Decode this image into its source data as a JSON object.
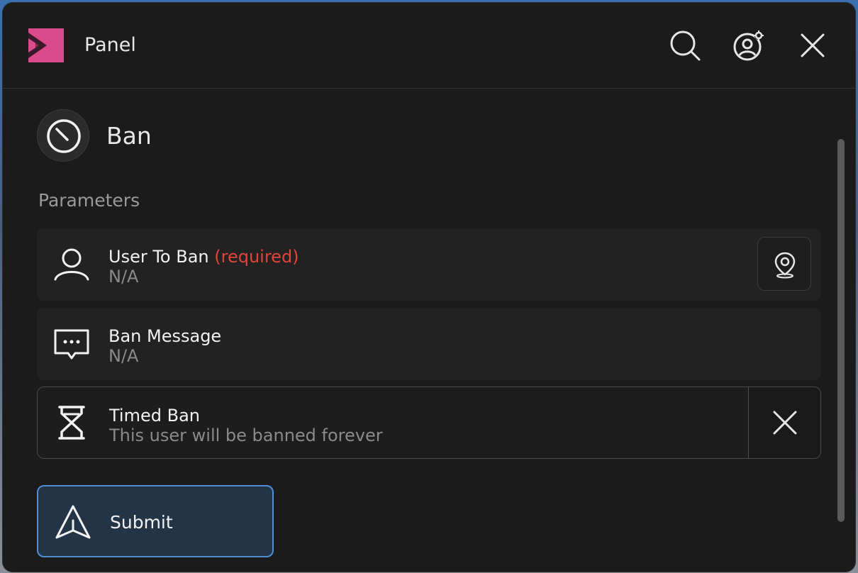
{
  "header": {
    "title": "Panel",
    "logo_icon": "brand-logo-icon",
    "logo_color": "#d94b8c"
  },
  "command": {
    "title": "Ban",
    "icon": "ban-icon"
  },
  "parameters": {
    "label": "Parameters",
    "items": [
      {
        "label": "User To Ban",
        "required_text": "(required)",
        "value": "N/A",
        "icon": "user-icon",
        "action_icon": "location-pin-icon"
      },
      {
        "label": "Ban Message",
        "value": "N/A",
        "icon": "message-icon"
      },
      {
        "label": "Timed Ban",
        "value": "This user will be banned forever",
        "icon": "hourglass-icon",
        "action_icon": "close-icon"
      }
    ]
  },
  "submit": {
    "label": "Submit",
    "icon": "send-icon",
    "accent": "#4f8fd6"
  },
  "colors": {
    "required": "#e0443a",
    "background": "#1b1b1b"
  }
}
